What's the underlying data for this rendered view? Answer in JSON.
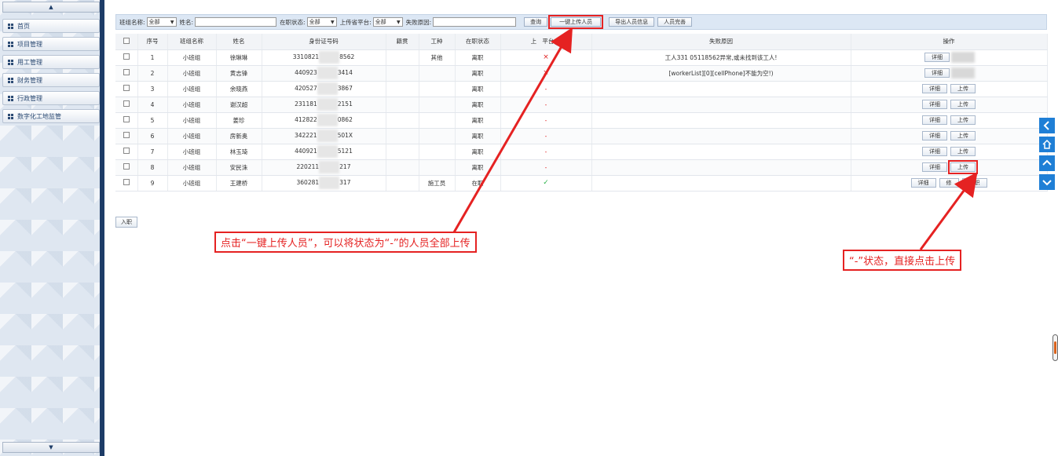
{
  "sidebar": {
    "scroll_up": "▲",
    "scroll_down": "▼",
    "items": [
      {
        "label": "首页"
      },
      {
        "label": "项目管理"
      },
      {
        "label": "用工管理"
      },
      {
        "label": "财务管理"
      },
      {
        "label": "行政管理"
      },
      {
        "label": "数字化工地监管"
      }
    ]
  },
  "toolbar": {
    "team_name_label": "班组名称:",
    "team_name_value": "全部",
    "name_label": "姓名:",
    "name_value": "",
    "status_label": "在职状态:",
    "status_value": "全部",
    "platform_label": "上传省平台:",
    "platform_value": "全部",
    "reason_label": "失败原因:",
    "reason_value": "",
    "query_button": "查询",
    "upload_all_button": "一键上传人员",
    "export_button": "导出人员信息",
    "complete_button": "人员完善"
  },
  "table": {
    "headers": [
      "序号",
      "班组名称",
      "姓名",
      "身份证号码",
      "籍贯",
      "工种",
      "在职状态",
      "上传省平台",
      "失败原因",
      "操作"
    ],
    "header_platform_visible": "上",
    "header_platform_tail": "平台",
    "rows": [
      {
        "no": "1",
        "team": "小班组",
        "name": "徐琳琳",
        "id_pre": "3310821",
        "id_post": "8562",
        "origin": "",
        "job": "其他",
        "status": "离职",
        "upload": "×",
        "upload_type": "x",
        "reason": "工人331            05118562异常,或未找到该工人!",
        "ops": [
          "详细"
        ],
        "op_blur": true
      },
      {
        "no": "2",
        "team": "小班组",
        "name": "黄志锋",
        "id_pre": "440923",
        "id_post": "3414",
        "origin": "",
        "job": "",
        "status": "离职",
        "upload": "×",
        "upload_type": "x",
        "reason": "[workerList][0][cellPhone]不能为空!)",
        "ops": [
          "详细"
        ],
        "op_blur": true
      },
      {
        "no": "3",
        "team": "小班组",
        "name": "余晓燕",
        "id_pre": "420527",
        "id_post": "3867",
        "origin": "",
        "job": "",
        "status": "离职",
        "upload": "-",
        "upload_type": "dash",
        "reason": "",
        "ops": [
          "详细",
          "上传"
        ],
        "op_blur": false
      },
      {
        "no": "4",
        "team": "小班组",
        "name": "谢汉超",
        "id_pre": "231181",
        "id_post": "2151",
        "origin": "",
        "job": "",
        "status": "离职",
        "upload": "-",
        "upload_type": "dash",
        "reason": "",
        "ops": [
          "详细",
          "上传"
        ],
        "op_blur": false
      },
      {
        "no": "5",
        "team": "小班组",
        "name": "姜珍",
        "id_pre": "412822",
        "id_post": "0862",
        "origin": "",
        "job": "",
        "status": "离职",
        "upload": "-",
        "upload_type": "dash",
        "reason": "",
        "ops": [
          "详细",
          "上传"
        ],
        "op_blur": false
      },
      {
        "no": "6",
        "team": "小班组",
        "name": "房新奥",
        "id_pre": "342221",
        "id_post": "501X",
        "origin": "",
        "job": "",
        "status": "离职",
        "upload": "-",
        "upload_type": "dash",
        "reason": "",
        "ops": [
          "详细",
          "上传"
        ],
        "op_blur": false
      },
      {
        "no": "7",
        "team": "小班组",
        "name": "林玉琦",
        "id_pre": "440921",
        "id_post": "5121",
        "origin": "",
        "job": "",
        "status": "离职",
        "upload": "-",
        "upload_type": "dash",
        "reason": "",
        "ops": [
          "详细",
          "上传"
        ],
        "op_blur": false
      },
      {
        "no": "8",
        "team": "小班组",
        "name": "安民洙",
        "id_pre": "220211",
        "id_post": "217",
        "origin": "",
        "job": "",
        "status": "离职",
        "upload": "-",
        "upload_type": "dash",
        "reason": "",
        "ops": [
          "详细",
          "上传"
        ],
        "op_blur": false
      },
      {
        "no": "9",
        "team": "小班组",
        "name": "王建桥",
        "id_pre": "360281",
        "id_post": "317",
        "origin": "",
        "job": "施工员",
        "status": "在职",
        "upload": "✓",
        "upload_type": "check",
        "reason": "",
        "ops": [
          "详细",
          "修",
          "离职"
        ],
        "op_blur": false
      }
    ]
  },
  "add_button": "入职",
  "annotations": {
    "note1": "点击“一键上传人员”，可以将状态为“-”的人员全部上传",
    "note2": "“-”状态，直接点击上传"
  },
  "colors": {
    "accent_red": "#e52222",
    "nav_blue": "#1f7fd6",
    "frame_navy": "#1d3c67"
  },
  "float_nav_icons": [
    "chevron-left-icon",
    "home-icon",
    "chevron-up-icon",
    "chevron-down-icon"
  ]
}
